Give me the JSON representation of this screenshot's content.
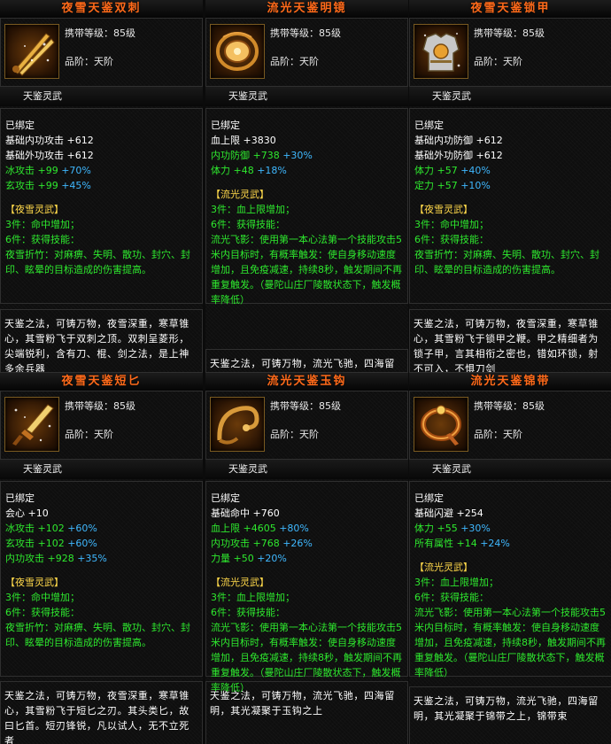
{
  "labels": {
    "carry_level": "携带等级：85级",
    "grade": "品阶：天阶",
    "category": "天鉴灵武",
    "bound": "已绑定"
  },
  "items": [
    {
      "name": "夜雪天鉴双刺",
      "icon": "twin-daggers-icon",
      "stats": [
        {
          "label": "基础内功攻击",
          "base": "+612",
          "bonus": ""
        },
        {
          "label": "基础外功攻击",
          "base": "+612",
          "bonus": ""
        },
        {
          "label": "冰攻击",
          "base": "+99",
          "bonus": "+70%"
        },
        {
          "label": "玄攻击",
          "base": "+99",
          "bonus": "+45%"
        }
      ],
      "set_name": "【夜雪灵武】",
      "set_lines": [
        "3件：命中增加；",
        "6件：获得技能："
      ],
      "skill_text": "夜雪折竹：对麻痹、失明、散功、封穴、封印、眩晕的目标造成的伤害提高。",
      "desc": "天鉴之法，可铸万物，夜雪深重，寒草锥心，其雪粉飞于双刺之顶。双刺呈菱形，尖端锐利，含有刀、棍、剑之法，是上神多余兵器"
    },
    {
      "name": "流光天鉴明镜",
      "icon": "mirror-icon",
      "stats": [
        {
          "label": "血上限",
          "base": "+3830",
          "bonus": ""
        },
        {
          "label": "内功防御",
          "base": "+738",
          "bonus": "+30%"
        },
        {
          "label": "体力",
          "base": "+48",
          "bonus": "+18%"
        }
      ],
      "set_name": "【流光灵武】",
      "set_lines": [
        "3件：血上限增加；",
        "6件：获得技能："
      ],
      "skill_text": "流光飞影：使用第一本心法第一个技能攻击5米内目标时，有概率触发：使自身移动速度增加，且免疫减速，持续8秒，触发期间不再重复触发。（曼陀山庄厂陵散状态下，触发概率降低）",
      "desc": "天鉴之法，可铸万物，流光飞驰，四海留明，其光凝聚于明镜之上，有光可鉴"
    },
    {
      "name": "夜雪天鉴锁甲",
      "icon": "armor-icon",
      "stats": [
        {
          "label": "基础内功防御",
          "base": "+612",
          "bonus": ""
        },
        {
          "label": "基础外功防御",
          "base": "+612",
          "bonus": ""
        },
        {
          "label": "体力",
          "base": "+57",
          "bonus": "+40%"
        },
        {
          "label": "定力",
          "base": "+57",
          "bonus": "+10%"
        }
      ],
      "set_name": "【夜雪灵武】",
      "set_lines": [
        "3件：命中增加；",
        "6件：获得技能："
      ],
      "skill_text": "夜雪折竹：对麻痹、失明、散功、封穴、封印、眩晕的目标造成的伤害提高。",
      "desc": "天鉴之法，可铸万物，夜雪深重，寒草锥心，其雪粉飞于锁甲之鞭。甲之精细者为锁子甲，言其相衔之密也，错如环锁，射不可入，不惧刀剑"
    },
    {
      "name": "夜雪天鉴短匕",
      "icon": "dagger-icon",
      "stats": [
        {
          "label": "会心",
          "base": "+10",
          "bonus": ""
        },
        {
          "label": "冰攻击",
          "base": "+102",
          "bonus": "+60%"
        },
        {
          "label": "玄攻击",
          "base": "+102",
          "bonus": "+60%"
        },
        {
          "label": "内功攻击",
          "base": "+928",
          "bonus": "+35%"
        }
      ],
      "set_name": "【夜雪灵武】",
      "set_lines": [
        "3件：命中增加；",
        "6件：获得技能："
      ],
      "skill_text": "夜雪折竹：对麻痹、失明、散功、封穴、封印、眩晕的目标造成的伤害提高。",
      "desc": "天鉴之法，可铸万物，夜雪深重，寒草锥心，其雪粉飞于短匕之刃。其头类匕，故曰匕首。短刃锋锐，凡以试人，无不立死者"
    },
    {
      "name": "流光天鉴玉钩",
      "icon": "jade-hook-icon",
      "stats": [
        {
          "label": "基础命中",
          "base": "+760",
          "bonus": ""
        },
        {
          "label": "血上限",
          "base": "+4605",
          "bonus": "+80%"
        },
        {
          "label": "内功攻击",
          "base": "+768",
          "bonus": "+26%"
        },
        {
          "label": "力量",
          "base": "+50",
          "bonus": "+20%"
        }
      ],
      "set_name": "【流光灵武】",
      "set_lines": [
        "3件：血上限增加；",
        "6件：获得技能："
      ],
      "skill_text": "流光飞影：使用第一本心法第一个技能攻击5米内目标时，有概率触发：使自身移动速度增加，且免疫减速，持续8秒，触发期间不再重复触发。（曼陀山庄厂陵散状态下，触发概率降低）",
      "desc": "天鉴之法，可铸万物，流光飞驰，四海留明，其光凝聚于玉钩之上"
    },
    {
      "name": "流光天鉴锦带",
      "icon": "brocade-belt-icon",
      "stats": [
        {
          "label": "基础闪避",
          "base": "+254",
          "bonus": ""
        },
        {
          "label": "体力",
          "base": "+55",
          "bonus": "+30%"
        },
        {
          "label": "所有属性",
          "base": "+14",
          "bonus": "+24%"
        }
      ],
      "set_name": "【流光灵武】",
      "set_lines": [
        "3件：血上限增加；",
        "6件：获得技能："
      ],
      "skill_text": "流光飞影：使用第一本心法第一个技能攻击5米内目标时，有概率触发：使自身移动速度增加，且免疫减速，持续8秒，触发期间不再重复触发。（曼陀山庄厂陵散状态下，触发概率降低）",
      "desc": "天鉴之法，可铸万物，流光飞驰，四海留明，其光凝聚于锦带之上，锦带束"
    }
  ]
}
